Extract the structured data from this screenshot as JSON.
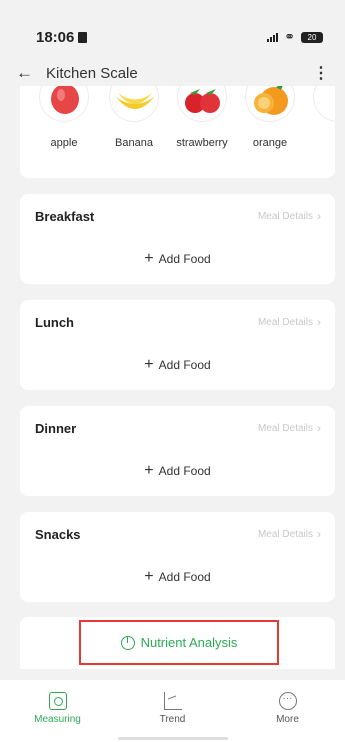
{
  "status_bar": {
    "time": "18:06",
    "battery": "20"
  },
  "app_bar": {
    "title": "Kitchen Scale"
  },
  "fruits": [
    {
      "name": "apple",
      "icon": "apple-icon"
    },
    {
      "name": "Banana",
      "icon": "banana-icon"
    },
    {
      "name": "strawberry",
      "icon": "strawberry-icon"
    },
    {
      "name": "orange",
      "icon": "orange-icon"
    }
  ],
  "meals": [
    {
      "title": "Breakfast",
      "details_label": "Meal Details",
      "add_label": "Add Food"
    },
    {
      "title": "Lunch",
      "details_label": "Meal Details",
      "add_label": "Add Food"
    },
    {
      "title": "Dinner",
      "details_label": "Meal Details",
      "add_label": "Add Food"
    },
    {
      "title": "Snacks",
      "details_label": "Meal Details",
      "add_label": "Add Food"
    }
  ],
  "nutrient": {
    "label": "Nutrient Analysis"
  },
  "tabs": [
    {
      "label": "Measuring",
      "icon": "scale-icon",
      "active": true
    },
    {
      "label": "Trend",
      "icon": "chart-icon",
      "active": false
    },
    {
      "label": "More",
      "icon": "more-icon",
      "active": false
    }
  ],
  "colors": {
    "accent": "#2eaa57",
    "highlight": "#e53935"
  }
}
